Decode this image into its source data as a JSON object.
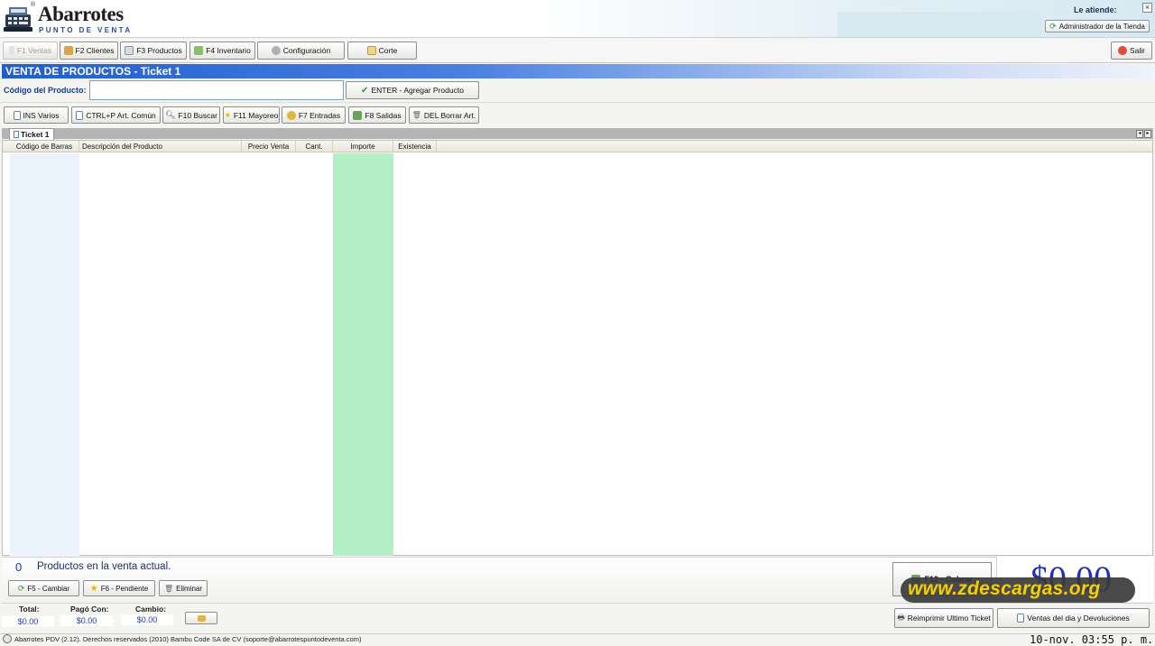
{
  "header": {
    "app_title": "Abarrotes",
    "app_subtitle": "PUNTO DE VENTA",
    "registered_mark": "®",
    "attended_by_label": "Le atiende:",
    "user_button": "Administrador de la Tienda",
    "close_glyph": "×"
  },
  "nav": {
    "ventas": "F1 Ventas",
    "clientes": "F2 Clientes",
    "productos": "F3 Productos",
    "inventario": "F4 Inventario",
    "configuracion": "Configuración",
    "corte": "Corte",
    "salir": "Salir"
  },
  "title": "VENTA DE PRODUCTOS - Ticket 1",
  "product_entry": {
    "label": "Código del Producto:",
    "value": "",
    "button": "ENTER - Agregar Producto"
  },
  "toolbar": {
    "varios": "INS Varios",
    "comun": "CTRL+P Art. Común",
    "buscar": "F10 Buscar",
    "mayoreo": "F11 Mayoreo",
    "entradas": "F7 Entradas",
    "salidas": "F8 Salidas",
    "borrar": "DEL Borrar Art."
  },
  "tabs": [
    {
      "label": "Ticket 1"
    }
  ],
  "table": {
    "columns": [
      "Código de Barras",
      "Descripción del Producto",
      "Precio Venta",
      "Cant.",
      "Importe",
      "Existencia"
    ],
    "rows": []
  },
  "summary": {
    "count": "0",
    "count_label": "Productos en la venta actual.",
    "cambiar": "F5 - Cambiar",
    "pendiente": "F6 - Pendiente",
    "eliminar": "Eliminar",
    "cobrar": "F12 - Cobrar",
    "total_big": "$0.00",
    "watermark": "www.zdescargas.org"
  },
  "totals": {
    "total_label": "Total:",
    "total_value": "$0.00",
    "pago_label": "Pagó Con:",
    "pago_value": "$0.00",
    "cambio_label": "Cambio:",
    "cambio_value": "$0.00",
    "reimprimir": "Reimprimir Ultimo Ticket",
    "ventas_dia": "Ventas del dia y Devoluciones"
  },
  "status": {
    "text": "Abarrotes PDV (2.12). Derechos reservados (2010) Bambu Code SA de CV (soporte@abarrotespuntodeventa.com)",
    "clock": "10-nov. 03:55 p. m."
  },
  "colors": {
    "title_bar": "#1f5ecf",
    "importe_column": "#b4eec4",
    "barras_column": "#eaf2fc",
    "total_text": "#1f2fb8"
  }
}
